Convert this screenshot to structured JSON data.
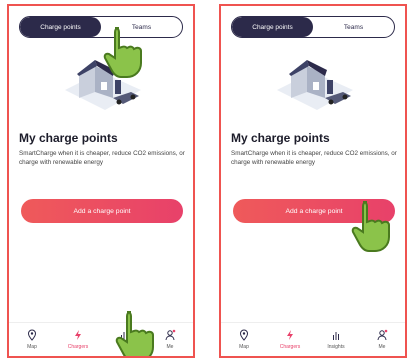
{
  "left": {
    "toggle": [
      "Charge points",
      "Teams"
    ],
    "title": "My charge points",
    "description": "SmartCharge when it is cheaper, reduce CO2 emissions, or charge with renewable energy",
    "add_button": "Add a charge point",
    "tabs": [
      "Map",
      "Chargers",
      "",
      "Me"
    ]
  },
  "right": {
    "toggle": [
      "Charge points",
      "Teams"
    ],
    "title": "My charge points",
    "description": "SmartCharge when it is cheaper, reduce CO2 emissions, or charge with renewable energy",
    "add_button": "Add a charge point",
    "tabs": [
      "Map",
      "Chargers",
      "Insights",
      "Me"
    ]
  },
  "colors": {
    "accent": "#e8416a",
    "dark": "#2c2a4a",
    "hand": "#8bc34a"
  },
  "icons": [
    "map-pin-icon",
    "charger-icon",
    "insights-icon",
    "me-icon",
    "pointer-hand-icon"
  ]
}
